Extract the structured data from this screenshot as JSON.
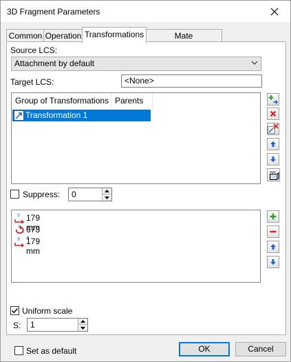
{
  "window": {
    "title": "3D Fragment Parameters"
  },
  "tabs": [
    {
      "label": "Common"
    },
    {
      "label": "Operation"
    },
    {
      "label": "Transformations"
    },
    {
      "label": "Mate Transformations"
    }
  ],
  "active_tab": "Transformations",
  "source_lcs": {
    "label": "Source LCS:",
    "value": "Attachment by default"
  },
  "target_lcs": {
    "label": "Target LCS:",
    "value": "<None>"
  },
  "transform_list": {
    "columns": [
      "Group of Transformations",
      "Parents"
    ],
    "rows": [
      {
        "name": "Transformation 1",
        "selected": true
      }
    ]
  },
  "suppress": {
    "label": "Suppress:",
    "checked": false,
    "value": "0"
  },
  "parameters": [
    {
      "icon": "y-axis-translate-icon",
      "text": "179 mm"
    },
    {
      "icon": "rotation-icon",
      "text": "673 °"
    },
    {
      "icon": "x-axis-translate-icon",
      "text": "179 mm"
    }
  ],
  "uniform_scale": {
    "label": "Uniform scale",
    "checked": true
  },
  "scale": {
    "label": "S:",
    "value": "1"
  },
  "set_default": {
    "label": "Set as default",
    "checked": false
  },
  "buttons": {
    "ok": "OK",
    "cancel": "Cancel"
  },
  "colors": {
    "selection": "#0078d7",
    "accent_green": "#2e9e2e",
    "accent_red": "#d92020",
    "accent_blue": "#1f5fd6"
  }
}
